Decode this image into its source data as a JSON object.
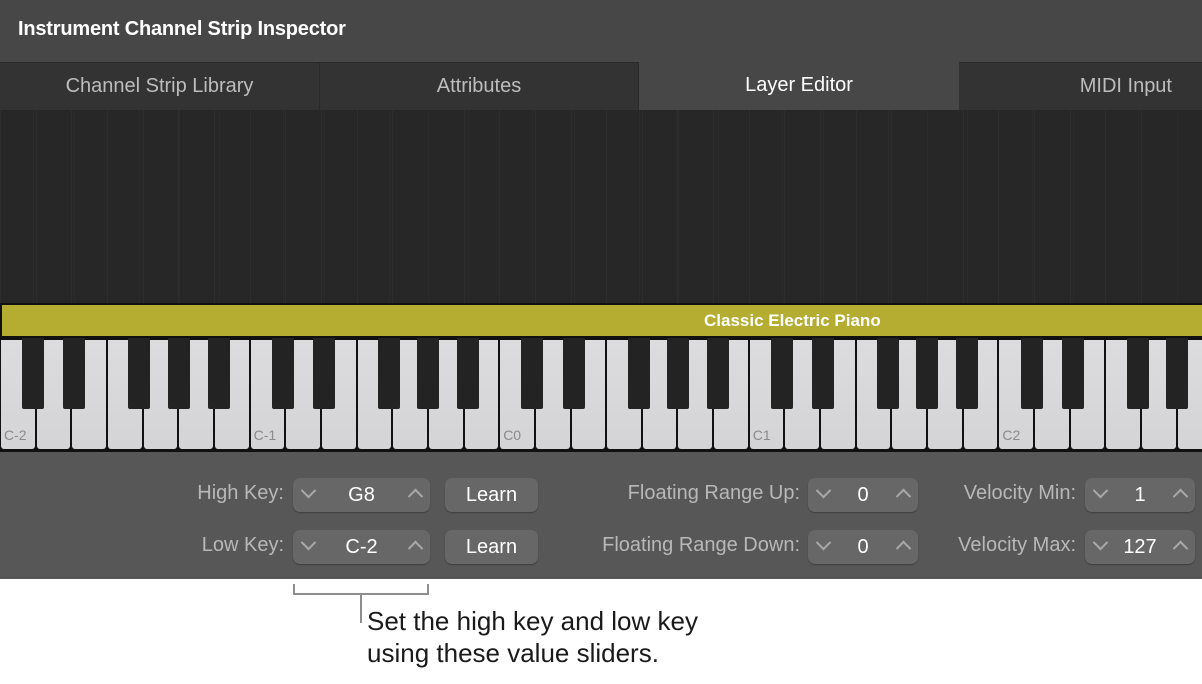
{
  "window": {
    "title": "Instrument Channel Strip Inspector"
  },
  "tabs": [
    {
      "label": "Channel Strip Library",
      "active": false
    },
    {
      "label": "Attributes",
      "active": false
    },
    {
      "label": "Layer Editor",
      "active": true
    },
    {
      "label": "MIDI Input",
      "active": false
    }
  ],
  "layer": {
    "name": "Classic Electric Piano",
    "color": "#b5ad31"
  },
  "keyboard": {
    "octave_labels": [
      "C-2",
      "C-1",
      "C0",
      "C1",
      "C2"
    ]
  },
  "controls": {
    "high_key": {
      "label": "High Key:",
      "value": "G8",
      "learn_label": "Learn"
    },
    "low_key": {
      "label": "Low Key:",
      "value": "C-2",
      "learn_label": "Learn"
    },
    "floating_range_up": {
      "label": "Floating Range Up:",
      "value": "0"
    },
    "floating_range_down": {
      "label": "Floating Range Down:",
      "value": "0"
    },
    "velocity_min": {
      "label": "Velocity Min:",
      "value": "1"
    },
    "velocity_max": {
      "label": "Velocity Max:",
      "value": "127"
    },
    "decrement_icon": "chevron-down-icon",
    "increment_icon": "chevron-up-icon"
  },
  "callout": {
    "line1": "Set the high key and low key",
    "line2": "using these value sliders."
  }
}
